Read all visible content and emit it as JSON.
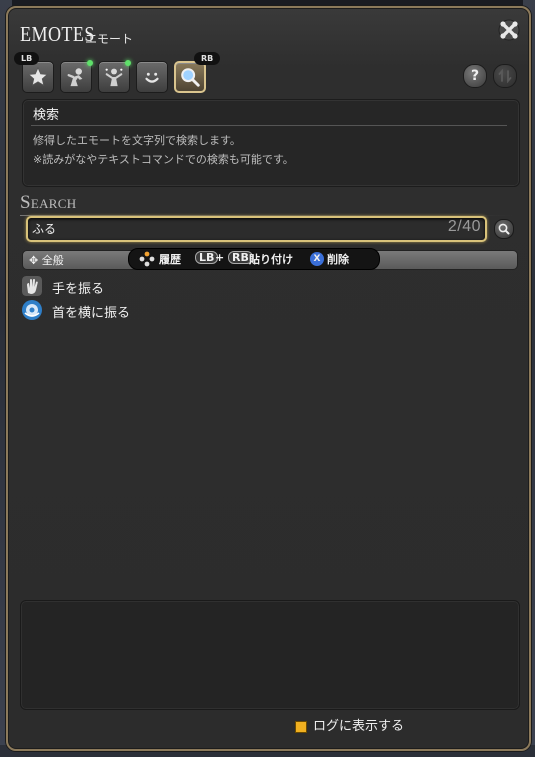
{
  "window": {
    "title_en": "EMOTES",
    "title_jp": "エモート"
  },
  "tabs": {
    "badge_left": "LB",
    "badge_right": "RB",
    "items": [
      {
        "name": "favorites",
        "icon": "star-icon",
        "active": false,
        "new": false
      },
      {
        "name": "general",
        "icon": "figure-icon",
        "active": false,
        "new": true
      },
      {
        "name": "special",
        "icon": "sparkle-figure-icon",
        "active": false,
        "new": true
      },
      {
        "name": "expressions",
        "icon": "smile-icon",
        "active": false,
        "new": false
      },
      {
        "name": "search",
        "icon": "magnifier-icon",
        "active": true,
        "new": false
      }
    ]
  },
  "help_button": "?",
  "info": {
    "heading": "検索",
    "line1": "修得したエモートを文字列で検索します。",
    "line2": "※読みがなやテキストコマンドでの検索も可能です。"
  },
  "search": {
    "section_title": "Search",
    "value": "ふる",
    "count": "2/40"
  },
  "category": {
    "label": "全般"
  },
  "hints": {
    "history": "履歴",
    "lb": "LB",
    "plus": "+",
    "rb": "RB",
    "paste": "貼り付け",
    "x_button": "X",
    "delete": "削除"
  },
  "results": [
    {
      "label": "手を振る",
      "icon": "wave-hand-icon"
    },
    {
      "label": "首を横に振る",
      "icon": "head-shake-icon"
    }
  ],
  "log": {
    "checked": true,
    "label": "ログに表示する"
  },
  "colors": {
    "accent_gold": "#d8c27a",
    "checkbox": "#f0b020",
    "new_dot": "#5fe06a"
  }
}
